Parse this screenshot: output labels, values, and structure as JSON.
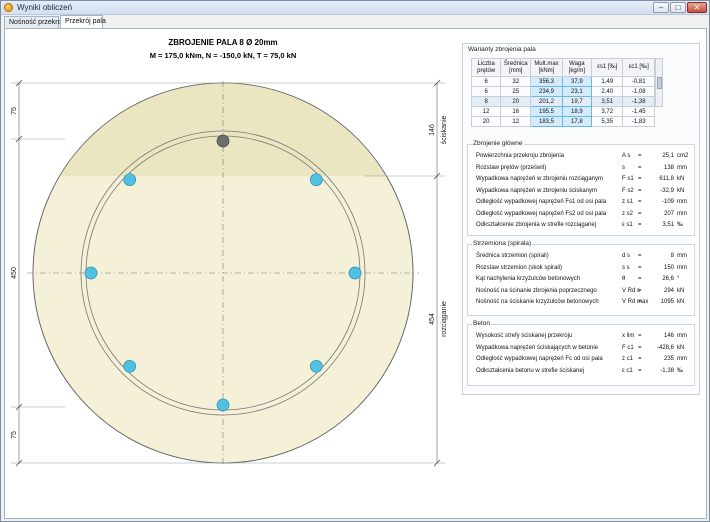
{
  "window": {
    "title": "Wyniki obliczeń"
  },
  "tabs": [
    {
      "label": "Nośność przekroju"
    },
    {
      "label": "Przekrój pala"
    }
  ],
  "drawing": {
    "title": "ZBROJENIE PALA 8 Ø 20mm",
    "forces": "M = 175,0 kNm,  N = -150,0 kN,  T = 75,0 kN",
    "left_dims": [
      "75",
      "450",
      "75"
    ],
    "right_dims": [
      "146",
      "454"
    ],
    "right_labels": [
      "ściskanie",
      "rozciąganie"
    ]
  },
  "variants": {
    "title": "Warianty zbrojenia pala",
    "headers": [
      "Liczba prętów",
      "Średnica [mm]",
      "Mult.max [kNm]",
      "Waga [kg/m]",
      "εs1 [‰]",
      "εc1 [‰]"
    ],
    "rows": [
      [
        "6",
        "32",
        "356,3",
        "37,9",
        "1,49",
        "-0,81"
      ],
      [
        "6",
        "25",
        "234,9",
        "23,1",
        "2,40",
        "-1,08"
      ],
      [
        "8",
        "20",
        "201,2",
        "19,7",
        "3,51",
        "-1,38"
      ],
      [
        "12",
        "16",
        "195,5",
        "18,9",
        "3,72",
        "-1,45"
      ],
      [
        "20",
        "12",
        "183,5",
        "17,8",
        "5,35",
        "-1,83"
      ]
    ]
  },
  "main_reinf": {
    "title": "Zbrojenie główne",
    "rows": [
      {
        "label": "Powierzchnia przekroju zbrojenia",
        "sym": "A s",
        "value": "25,1",
        "unit": "cm2"
      },
      {
        "label": "Rozstaw prętów (prześwit)",
        "sym": "s",
        "value": "138",
        "unit": "mm"
      },
      {
        "label": "Wypadkowa naprężeń w zbrojeniu rozciąganym",
        "sym": "F s1",
        "value": "611,8",
        "unit": "kN"
      },
      {
        "label": "Wypadkowa naprężeń w zbrojeniu ściskanym",
        "sym": "F s2",
        "value": "-32,9",
        "unit": "kN"
      },
      {
        "label": "Odległość wypadkowej naprężeń Fs1 od osi pala",
        "sym": "z s1",
        "value": "-109",
        "unit": "mm"
      },
      {
        "label": "Odległość wypadkowej naprężeń Fs2 od osi pala",
        "sym": "z s2",
        "value": "207",
        "unit": "mm"
      },
      {
        "label": "Odkształcenie zbrojenia w strefie rozciąganej",
        "sym": "ε s1",
        "value": "3,51",
        "unit": "‰"
      }
    ]
  },
  "stirrups": {
    "title": "Strzemiona (spirala)",
    "rows": [
      {
        "label": "Średnica strzemion (spirali)",
        "sym": "d s",
        "value": "8",
        "unit": "mm"
      },
      {
        "label": "Rozstaw strzemion (skok spirali)",
        "sym": "s s",
        "value": "150",
        "unit": "mm"
      },
      {
        "label": "Kąt nachylenia krzyżulców betonowych",
        "sym": "θ",
        "value": "26,6",
        "unit": "°"
      },
      {
        "label": "Nośność na ścinanie zbrojenia poprzecznego",
        "sym": "V Rd s",
        "value": "294",
        "unit": "kN"
      },
      {
        "label": "Nośność na ściskanie krzyżulców betonowych",
        "sym": "V Rd max",
        "value": "1095",
        "unit": "kN"
      }
    ]
  },
  "concrete": {
    "title": "Beton",
    "rows": [
      {
        "label": "Wysokość strefy ściskanej przekroju",
        "sym": "x lim",
        "value": "146",
        "unit": "mm"
      },
      {
        "label": "Wypadkowa naprężeń ściskających w betonie",
        "sym": "F c1",
        "value": "-428,6",
        "unit": "kN"
      },
      {
        "label": "Odległość wypadkowej naprężeń Fc od osi pala",
        "sym": "z c1",
        "value": "235",
        "unit": "mm"
      },
      {
        "label": "Odkształcenia betonu w strefie ściskanej",
        "sym": "ε c1",
        "value": "-1,38",
        "unit": "‰"
      }
    ]
  },
  "colors": {
    "concrete": "#f5f0d8",
    "compression": "#ebe6c2",
    "rebar": "#52c1e0",
    "rebar_compressed": "#6d6d6d"
  }
}
